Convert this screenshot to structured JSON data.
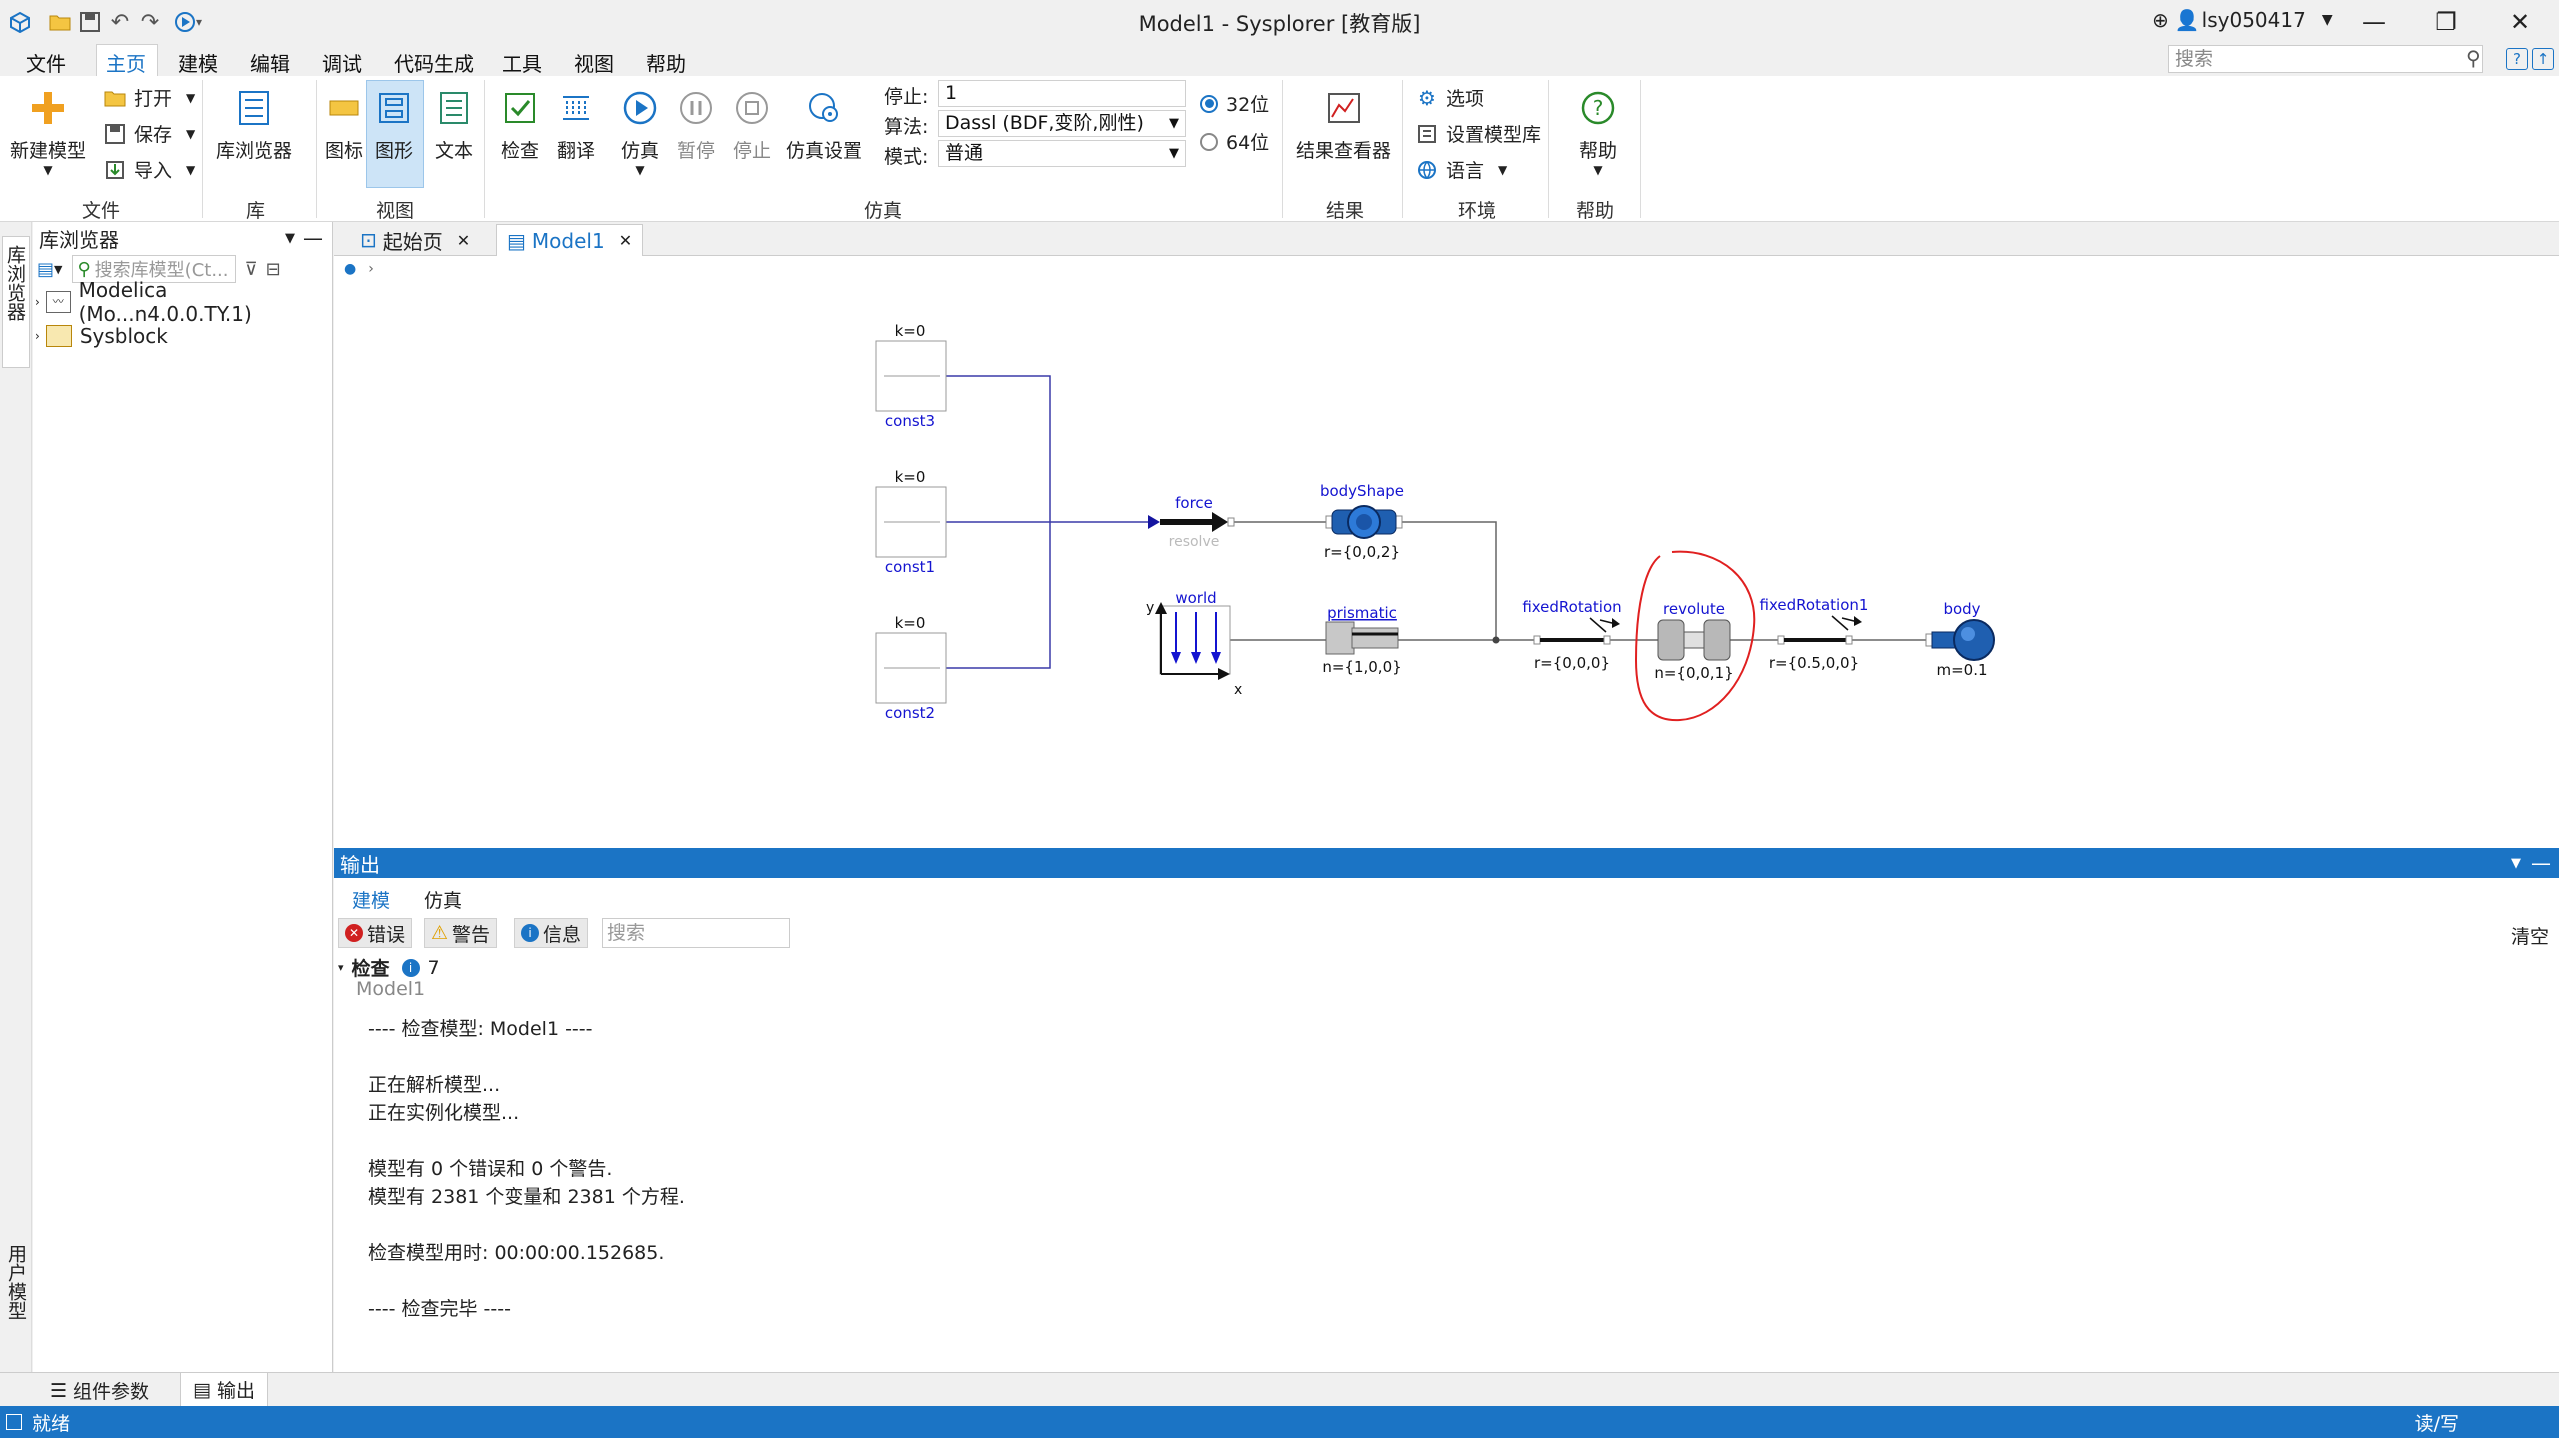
{
  "window": {
    "title": "Model1 - Sysplorer [教育版]",
    "user": "lsy050417"
  },
  "menu": [
    "文件",
    "主页",
    "建模",
    "编辑",
    "调试",
    "代码生成",
    "工具",
    "视图",
    "帮助"
  ],
  "search_top": {
    "placeholder": "搜索"
  },
  "ribbon": {
    "file": {
      "new_model": "新建模型",
      "open": "打开",
      "save": "保存",
      "import": "导入",
      "group": "文件"
    },
    "library": {
      "browser": "库浏览器",
      "group": "库"
    },
    "view": {
      "icon": "图标",
      "diagram": "图形",
      "text": "文本",
      "group": "视图"
    },
    "sim": {
      "check": "检查",
      "translate": "翻译",
      "simulate": "仿真",
      "pause": "暂停",
      "stop": "停止",
      "settings": "仿真设置",
      "group": "仿真"
    },
    "sim_params": {
      "stop_label": "停止:",
      "stop_value": "1",
      "algo_label": "算法:",
      "algo_value": "Dassl (BDF,变阶,刚性)",
      "mode_label": "模式:",
      "mode_value": "普通",
      "bit32": "32位",
      "bit64": "64位"
    },
    "results": {
      "viewer": "结果查看器",
      "group": "结果"
    },
    "env": {
      "options": "选项",
      "set_lib": "设置模型库",
      "language": "语言",
      "group": "环境"
    },
    "help": {
      "label": "帮助",
      "group": "帮助"
    }
  },
  "left_tabs": {
    "library": "库浏览器",
    "user": "用户模型"
  },
  "lib_panel": {
    "title": "库浏览器",
    "search_placeholder": "搜索库模型(Ct...",
    "items": [
      "Modelica (Mo...n4.0.0.TY.1)",
      "Sysblock"
    ]
  },
  "doc_tabs": [
    "起始页",
    "Model1"
  ],
  "diagram": {
    "const3": {
      "name": "const3",
      "param": "k=0"
    },
    "const1": {
      "name": "const1",
      "param": "k=0"
    },
    "const2": {
      "name": "const2",
      "param": "k=0"
    },
    "force": {
      "name": "force",
      "sub": "resolve"
    },
    "bodyShape": {
      "name": "bodyShape",
      "param": "r={0,0,2}"
    },
    "world": {
      "name": "world",
      "y": "y",
      "x": "x"
    },
    "prismatic": {
      "name": "prismatic",
      "param": "n={1,0,0}"
    },
    "fixedRotation": {
      "name": "fixedRotation",
      "param": "r={0,0,0}"
    },
    "revolute": {
      "name": "revolute",
      "param": "n={0,0,1}"
    },
    "fixedRotation1": {
      "name": "fixedRotation1",
      "param": "r={0.5,0,0}"
    },
    "body": {
      "name": "body",
      "param": "m=0.1"
    }
  },
  "output": {
    "title": "输出",
    "tabs": [
      "建模",
      "仿真"
    ],
    "filters": {
      "error": "错误",
      "warning": "警告",
      "info": "信息",
      "search_placeholder": "搜索",
      "clear": "清空"
    },
    "check_label": "检查",
    "check_count": "7",
    "model_name": "Model1",
    "lines": [
      "---- 检查模型: Model1 ----",
      "",
      "正在解析模型...",
      "正在实例化模型...",
      "",
      "模型有 0 个错误和 0 个警告.",
      "模型有 2381 个变量和 2381 个方程.",
      "",
      "检查模型用时: 00:00:00.152685.",
      "",
      "---- 检查完毕 ----"
    ]
  },
  "bottom_tabs": [
    "组件参数",
    "输出"
  ],
  "status": {
    "left": "就绪",
    "right": "读/写"
  },
  "colors": {
    "accent": "#1b74c5",
    "diagram_label": "#1414d0",
    "annotation": "#e02020"
  }
}
